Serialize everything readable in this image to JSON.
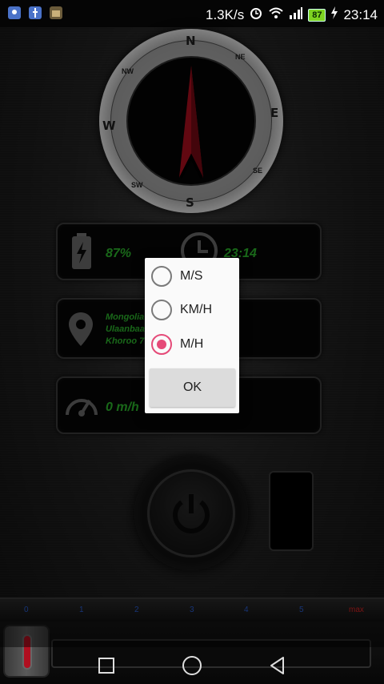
{
  "status_bar": {
    "network_speed": "1.3K/s",
    "battery_level": "87",
    "time": "23:14"
  },
  "compass": {
    "cardinals": {
      "n": "N",
      "e": "E",
      "s": "S",
      "w": "W"
    },
    "ordinals": {
      "ne": "NE",
      "se": "SE",
      "sw": "SW",
      "nw": "NW"
    }
  },
  "panels": {
    "battery": {
      "value": "87%"
    },
    "clock": {
      "value": "23:14"
    },
    "location": {
      "line1": "Mongolia",
      "line2": "Ulaanbaatar",
      "line3": "Khoroo 7"
    },
    "speed": {
      "value": "0 m/h"
    }
  },
  "ruler": {
    "ticks": [
      "0",
      "1",
      "2",
      "3",
      "4",
      "5",
      "max"
    ]
  },
  "dialog": {
    "options": [
      "M/S",
      "KM/H",
      "M/H"
    ],
    "selected": "M/H",
    "ok_label": "OK"
  },
  "colors": {
    "accent": "#e54a78",
    "value_green": "#2fbe2f",
    "needle_red": "#b30f1f"
  }
}
